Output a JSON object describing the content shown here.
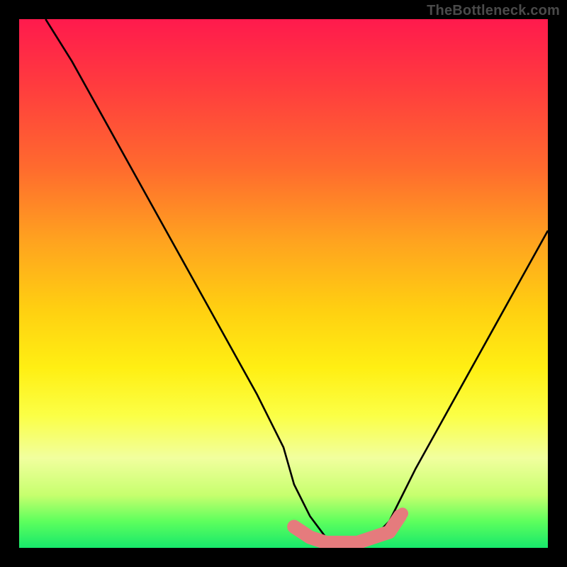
{
  "watermark": "TheBottleneck.com",
  "chart_data": {
    "type": "line",
    "title": "",
    "xlabel": "",
    "ylabel": "",
    "xlim": [
      0,
      100
    ],
    "ylim": [
      0,
      100
    ],
    "grid": false,
    "legend": false,
    "annotations": [],
    "notes": "Axes are unlabeled in the source image; x/y are abstract 0–100. Background gradient runs red (top) → green (bottom). Pink rounded segment marks the valley floor.",
    "series": [
      {
        "name": "bottleneck-curve",
        "color": "#000000",
        "x": [
          5,
          10,
          15,
          20,
          25,
          30,
          35,
          40,
          45,
          50,
          52,
          55,
          58,
          61,
          64,
          67,
          70,
          72,
          75,
          80,
          85,
          90,
          95,
          100
        ],
        "y": [
          100,
          92,
          83,
          74,
          65,
          56,
          47,
          38,
          29,
          19,
          12,
          6,
          2,
          1,
          1,
          2,
          5,
          9,
          15,
          24,
          33,
          42,
          51,
          60
        ]
      },
      {
        "name": "valley-marker",
        "color": "#e57b7d",
        "x": [
          52,
          55,
          58,
          61,
          64,
          67,
          70,
          72
        ],
        "y": [
          4,
          2,
          1,
          1,
          1,
          2,
          3,
          6
        ]
      }
    ],
    "gradient_stops": [
      {
        "pos": 0.0,
        "color": "#ff1a4d"
      },
      {
        "pos": 0.12,
        "color": "#ff3a3f"
      },
      {
        "pos": 0.28,
        "color": "#ff6a2e"
      },
      {
        "pos": 0.42,
        "color": "#ffa31f"
      },
      {
        "pos": 0.55,
        "color": "#ffd011"
      },
      {
        "pos": 0.66,
        "color": "#ffef13"
      },
      {
        "pos": 0.75,
        "color": "#fbff46"
      },
      {
        "pos": 0.83,
        "color": "#f1ff9e"
      },
      {
        "pos": 0.9,
        "color": "#c7ff6e"
      },
      {
        "pos": 0.95,
        "color": "#5dff5d"
      },
      {
        "pos": 1.0,
        "color": "#17e86b"
      }
    ]
  }
}
